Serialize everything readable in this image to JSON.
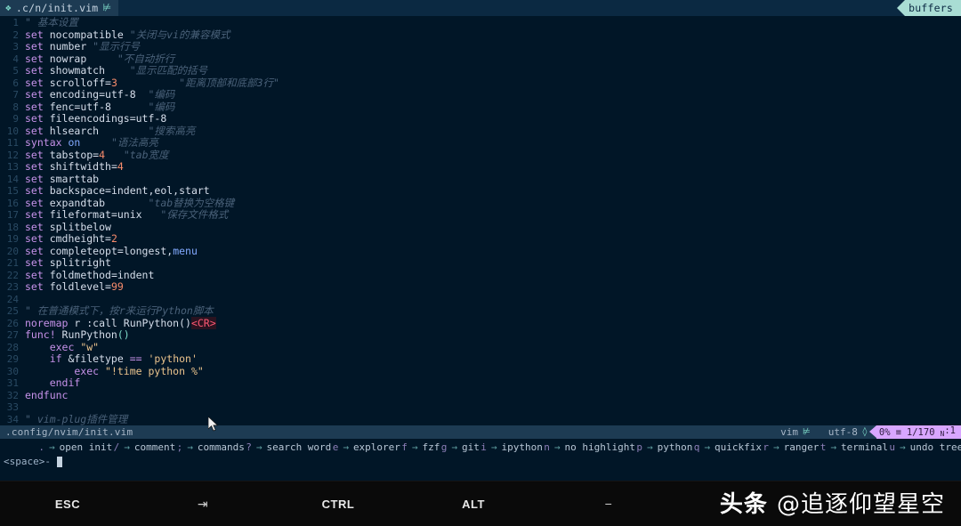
{
  "window": {
    "tab_label": ".c/n/init.vim",
    "tab_icon": "vim-icon",
    "buffers_label": "buffers"
  },
  "editor": {
    "lines": [
      {
        "n": "1",
        "segments": [
          {
            "t": "\" 基本设置",
            "c": "cmt"
          }
        ]
      },
      {
        "n": "2",
        "segments": [
          {
            "t": "set ",
            "c": "kw"
          },
          {
            "t": "nocompatible ",
            "c": "id"
          },
          {
            "t": "\"关闭与vi的兼容模式",
            "c": "cmt"
          }
        ]
      },
      {
        "n": "3",
        "segments": [
          {
            "t": "set ",
            "c": "kw"
          },
          {
            "t": "number ",
            "c": "id"
          },
          {
            "t": "\"显示行号",
            "c": "cmt"
          }
        ]
      },
      {
        "n": "4",
        "segments": [
          {
            "t": "set ",
            "c": "kw"
          },
          {
            "t": "nowrap     ",
            "c": "id"
          },
          {
            "t": "\"不自动折行",
            "c": "cmt"
          }
        ]
      },
      {
        "n": "5",
        "segments": [
          {
            "t": "set ",
            "c": "kw"
          },
          {
            "t": "showmatch    ",
            "c": "id"
          },
          {
            "t": "\"显示匹配的括号",
            "c": "cmt"
          }
        ]
      },
      {
        "n": "6",
        "segments": [
          {
            "t": "set ",
            "c": "kw"
          },
          {
            "t": "scrolloff=",
            "c": "id"
          },
          {
            "t": "3",
            "c": "num"
          },
          {
            "t": "          ",
            "c": "id"
          },
          {
            "t": "\"距离顶部和底部3行\"",
            "c": "cmt"
          }
        ]
      },
      {
        "n": "7",
        "segments": [
          {
            "t": "set ",
            "c": "kw"
          },
          {
            "t": "encoding=utf-8  ",
            "c": "id"
          },
          {
            "t": "\"编码",
            "c": "cmt"
          }
        ]
      },
      {
        "n": "8",
        "segments": [
          {
            "t": "set ",
            "c": "kw"
          },
          {
            "t": "fenc=utf-8      ",
            "c": "id"
          },
          {
            "t": "\"编码",
            "c": "cmt"
          }
        ]
      },
      {
        "n": "9",
        "segments": [
          {
            "t": "set ",
            "c": "kw"
          },
          {
            "t": "fileencodings=utf-8",
            "c": "id"
          }
        ]
      },
      {
        "n": "10",
        "segments": [
          {
            "t": "set ",
            "c": "kw"
          },
          {
            "t": "hlsearch        ",
            "c": "id"
          },
          {
            "t": "\"搜索高亮",
            "c": "cmt"
          }
        ]
      },
      {
        "n": "11",
        "segments": [
          {
            "t": "syntax ",
            "c": "kw"
          },
          {
            "t": "on",
            "c": "val"
          },
          {
            "t": "     ",
            "c": "id"
          },
          {
            "t": "\"语法高亮",
            "c": "cmt"
          }
        ]
      },
      {
        "n": "12",
        "segments": [
          {
            "t": "set ",
            "c": "kw"
          },
          {
            "t": "tabstop=",
            "c": "id"
          },
          {
            "t": "4",
            "c": "num"
          },
          {
            "t": "   ",
            "c": "id"
          },
          {
            "t": "\"tab宽度",
            "c": "cmt"
          }
        ]
      },
      {
        "n": "13",
        "segments": [
          {
            "t": "set ",
            "c": "kw"
          },
          {
            "t": "shiftwidth=",
            "c": "id"
          },
          {
            "t": "4",
            "c": "num"
          }
        ]
      },
      {
        "n": "14",
        "segments": [
          {
            "t": "set ",
            "c": "kw"
          },
          {
            "t": "smarttab",
            "c": "id"
          }
        ]
      },
      {
        "n": "15",
        "segments": [
          {
            "t": "set ",
            "c": "kw"
          },
          {
            "t": "backspace=indent,eol,start",
            "c": "id"
          }
        ]
      },
      {
        "n": "16",
        "segments": [
          {
            "t": "set ",
            "c": "kw"
          },
          {
            "t": "expandtab       ",
            "c": "id"
          },
          {
            "t": "\"tab替换为空格键",
            "c": "cmt"
          }
        ]
      },
      {
        "n": "17",
        "segments": [
          {
            "t": "set ",
            "c": "kw"
          },
          {
            "t": "fileformat=unix   ",
            "c": "id"
          },
          {
            "t": "\"保存文件格式",
            "c": "cmt"
          }
        ]
      },
      {
        "n": "18",
        "segments": [
          {
            "t": "set ",
            "c": "kw"
          },
          {
            "t": "splitbelow",
            "c": "id"
          }
        ]
      },
      {
        "n": "19",
        "segments": [
          {
            "t": "set ",
            "c": "kw"
          },
          {
            "t": "cmdheight=",
            "c": "id"
          },
          {
            "t": "2",
            "c": "num"
          }
        ]
      },
      {
        "n": "20",
        "segments": [
          {
            "t": "set ",
            "c": "kw"
          },
          {
            "t": "completeopt=longest,",
            "c": "id"
          },
          {
            "t": "menu",
            "c": "val"
          }
        ]
      },
      {
        "n": "21",
        "segments": [
          {
            "t": "set ",
            "c": "kw"
          },
          {
            "t": "splitright",
            "c": "id"
          }
        ]
      },
      {
        "n": "22",
        "segments": [
          {
            "t": "set ",
            "c": "kw"
          },
          {
            "t": "foldmethod=indent",
            "c": "id"
          }
        ]
      },
      {
        "n": "23",
        "segments": [
          {
            "t": "set ",
            "c": "kw"
          },
          {
            "t": "foldlevel=",
            "c": "id"
          },
          {
            "t": "99",
            "c": "num"
          }
        ]
      },
      {
        "n": "24",
        "segments": []
      },
      {
        "n": "25",
        "segments": [
          {
            "t": "\" 在普通模式下，按r来运行Python脚本",
            "c": "cmt"
          }
        ]
      },
      {
        "n": "26",
        "segments": [
          {
            "t": "noremap ",
            "c": "kw"
          },
          {
            "t": "r :call RunPython()",
            "c": "id"
          },
          {
            "t": "<CR>",
            "c": "spec"
          }
        ]
      },
      {
        "n": "27",
        "segments": [
          {
            "t": "func! ",
            "c": "kw"
          },
          {
            "t": "RunPython",
            "c": "id"
          },
          {
            "t": "()",
            "c": "paren"
          }
        ]
      },
      {
        "n": "28",
        "segments": [
          {
            "t": "    exec ",
            "c": "kw"
          },
          {
            "t": "\"w\"",
            "c": "str"
          }
        ]
      },
      {
        "n": "29",
        "segments": [
          {
            "t": "    if ",
            "c": "kw"
          },
          {
            "t": "&filetype ",
            "c": "id"
          },
          {
            "t": "== ",
            "c": "op"
          },
          {
            "t": "'python'",
            "c": "str"
          }
        ]
      },
      {
        "n": "30",
        "segments": [
          {
            "t": "        exec ",
            "c": "kw"
          },
          {
            "t": "\"!time python %\"",
            "c": "str"
          }
        ]
      },
      {
        "n": "31",
        "segments": [
          {
            "t": "    endif",
            "c": "kw"
          }
        ]
      },
      {
        "n": "32",
        "segments": [
          {
            "t": "endfunc",
            "c": "kw"
          }
        ]
      },
      {
        "n": "33",
        "segments": []
      },
      {
        "n": "34",
        "segments": [
          {
            "t": "\" vim-plug插件管理",
            "c": "cmt"
          }
        ]
      }
    ]
  },
  "statusline": {
    "file_path": ".config/nvim/init.vim",
    "mode_label": "vim",
    "mode_icon": "vim-icon",
    "encoding_label": "utf-8",
    "encoding_icon": "unicode-icon",
    "percent": "0%",
    "lines_icon": "≡",
    "position": "1/170",
    "column_mode": "N",
    "column": ":1"
  },
  "whichkey": {
    "items": [
      {
        "key": ".",
        "arrow": "→",
        "label": "open init"
      },
      {
        "key": "/",
        "arrow": "→",
        "label": "comment"
      },
      {
        "key": ";",
        "arrow": "→",
        "label": "commands"
      },
      {
        "key": "?",
        "arrow": "→",
        "label": "search word"
      },
      {
        "key": "e",
        "arrow": "→",
        "label": "explorer"
      },
      {
        "key": "f",
        "arrow": "→",
        "label": "fzf"
      },
      {
        "key": "g",
        "arrow": "→",
        "label": "git"
      },
      {
        "key": "i",
        "arrow": "→",
        "label": "ipython"
      },
      {
        "key": "n",
        "arrow": "→",
        "label": "no highlight"
      },
      {
        "key": "p",
        "arrow": "→",
        "label": "python"
      },
      {
        "key": "q",
        "arrow": "→",
        "label": "quickfix"
      },
      {
        "key": "r",
        "arrow": "→",
        "label": "ranger"
      },
      {
        "key": "t",
        "arrow": "→",
        "label": "terminal"
      },
      {
        "key": "u",
        "arrow": "→",
        "label": "undo tree"
      }
    ],
    "command_prompt": "<space>-"
  },
  "toolbar": {
    "keys": [
      {
        "label": "ESC",
        "name": "esc-key",
        "glyph": false
      },
      {
        "label": "⇥",
        "name": "tab-key",
        "glyph": true
      },
      {
        "label": "CTRL",
        "name": "ctrl-key",
        "glyph": false
      },
      {
        "label": "ALT",
        "name": "alt-key",
        "glyph": false
      },
      {
        "label": "−",
        "name": "minus-key",
        "glyph": true
      }
    ]
  },
  "watermark": {
    "brand": "头条 ",
    "handle": "@追逐仰望星空"
  },
  "colors": {
    "editor_bg": "#011627",
    "tabline_bg": "#0b2942",
    "statusline_bg": "#1d3b53",
    "buffers_tag": "#a9ddd4",
    "position_badge": "#d8a6ff",
    "toolbar_bg": "#0a0a0a"
  }
}
